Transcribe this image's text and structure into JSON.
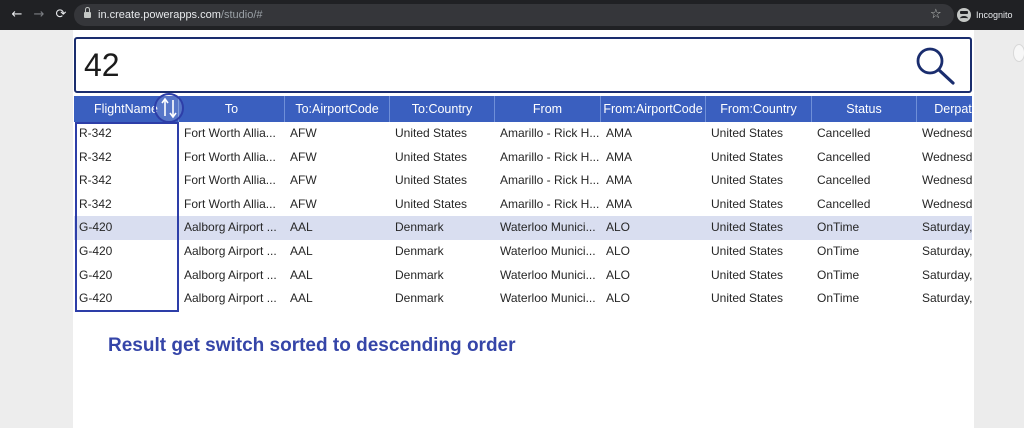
{
  "browser": {
    "url_host": "in.create.powerapps.com",
    "url_path": "/studio/#",
    "incognito_label": "Incognito",
    "back_glyph": "←",
    "forward_glyph": "→",
    "reload_glyph": "⟳",
    "star_glyph": "☆",
    "icons": [
      "back-icon",
      "forward-icon",
      "reload-icon",
      "lock-icon",
      "star-icon",
      "incognito-icon"
    ]
  },
  "search": {
    "value": "42",
    "icon": "search-icon",
    "accent_color": "#1a2d6e"
  },
  "table": {
    "header_color": "#3a5fbf",
    "columns": [
      "FlightName",
      "To",
      "To:AirportCode",
      "To:Country",
      "From",
      "From:AirportCode",
      "From:Country",
      "Status",
      "Derpatu"
    ],
    "rows": [
      [
        "R-342",
        "Fort Worth Allia...",
        "AFW",
        "United States",
        "Amarillo - Rick H...",
        "AMA",
        "United States",
        "Cancelled",
        "Wednesd"
      ],
      [
        "R-342",
        "Fort Worth Allia...",
        "AFW",
        "United States",
        "Amarillo - Rick H...",
        "AMA",
        "United States",
        "Cancelled",
        "Wednesd"
      ],
      [
        "R-342",
        "Fort Worth Allia...",
        "AFW",
        "United States",
        "Amarillo - Rick H...",
        "AMA",
        "United States",
        "Cancelled",
        "Wednesd"
      ],
      [
        "R-342",
        "Fort Worth Allia...",
        "AFW",
        "United States",
        "Amarillo - Rick H...",
        "AMA",
        "United States",
        "Cancelled",
        "Wednesd"
      ],
      [
        "G-420",
        "Aalborg Airport ...",
        "AAL",
        "Denmark",
        "Waterloo Munici...",
        "ALO",
        "United States",
        "OnTime",
        "Saturday,"
      ],
      [
        "G-420",
        "Aalborg Airport ...",
        "AAL",
        "Denmark",
        "Waterloo Munici...",
        "ALO",
        "United States",
        "OnTime",
        "Saturday,"
      ],
      [
        "G-420",
        "Aalborg Airport ...",
        "AAL",
        "Denmark",
        "Waterloo Munici...",
        "ALO",
        "United States",
        "OnTime",
        "Saturday,"
      ],
      [
        "G-420",
        "Aalborg Airport ...",
        "AAL",
        "Denmark",
        "Waterloo Munici...",
        "ALO",
        "United States",
        "OnTime",
        "Saturday,"
      ]
    ],
    "selected_row": 4,
    "sort_icon": "sort-arrows-icon"
  },
  "annotation": {
    "text": "Result get switch sorted to descending order",
    "color": "#3545a8"
  }
}
